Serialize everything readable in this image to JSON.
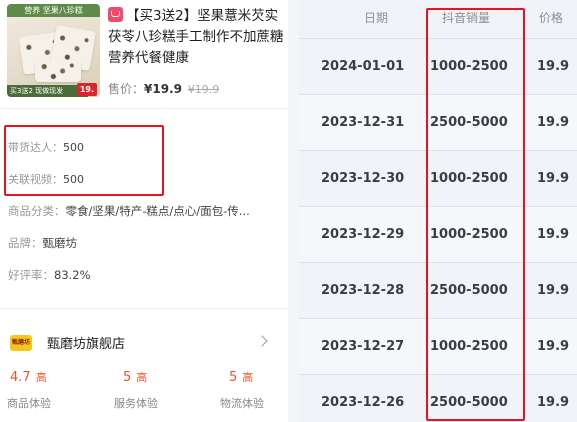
{
  "product": {
    "image_top_tag": "营养 坚果八珍糕",
    "image_bottom_tag": "买3送2 现做现发",
    "image_price_tag": "19.",
    "title": "【买3送2】坚果薏米芡实茯苓八珍糕手工制作不加蔗糖营养代餐健康",
    "price_label": "售价：",
    "price_now": "¥19.9",
    "price_old": "¥19.9"
  },
  "stats": {
    "influencers_label": "带货达人：",
    "influencers_value": "500",
    "videos_label": "关联视频：",
    "videos_value": "500"
  },
  "details": {
    "category_label": "商品分类：",
    "category_value": "零食/坚果/特产-糕点/点心/面包-传...",
    "brand_label": "品牌：",
    "brand_value": "甄磨坊",
    "rating_label": "好评率：",
    "rating_value": "83.2%"
  },
  "store": {
    "logo_text": "甄磨坊",
    "name": "甄磨坊旗舰店",
    "scores": [
      {
        "value": "4.7",
        "level": "高",
        "label": "商品体验"
      },
      {
        "value": "5",
        "level": "高",
        "label": "服务体验"
      },
      {
        "value": "5",
        "level": "高",
        "label": "物流体验"
      }
    ]
  },
  "sales_table": {
    "headers": [
      "日期",
      "抖音销量",
      "价格"
    ],
    "rows": [
      {
        "date": "2024-01-01",
        "sales": "1000-2500",
        "price": "19.9"
      },
      {
        "date": "2023-12-31",
        "sales": "2500-5000",
        "price": "19.9"
      },
      {
        "date": "2023-12-30",
        "sales": "1000-2500",
        "price": "19.9"
      },
      {
        "date": "2023-12-29",
        "sales": "1000-2500",
        "price": "19.9"
      },
      {
        "date": "2023-12-28",
        "sales": "2500-5000",
        "price": "19.9"
      },
      {
        "date": "2023-12-27",
        "sales": "1000-2500",
        "price": "19.9"
      },
      {
        "date": "2023-12-26",
        "sales": "2500-5000",
        "price": "19.9"
      }
    ]
  },
  "colors": {
    "highlight_border": "#e4151d",
    "score_orange": "#e8542f",
    "tag_pink": "#f24a6a"
  }
}
